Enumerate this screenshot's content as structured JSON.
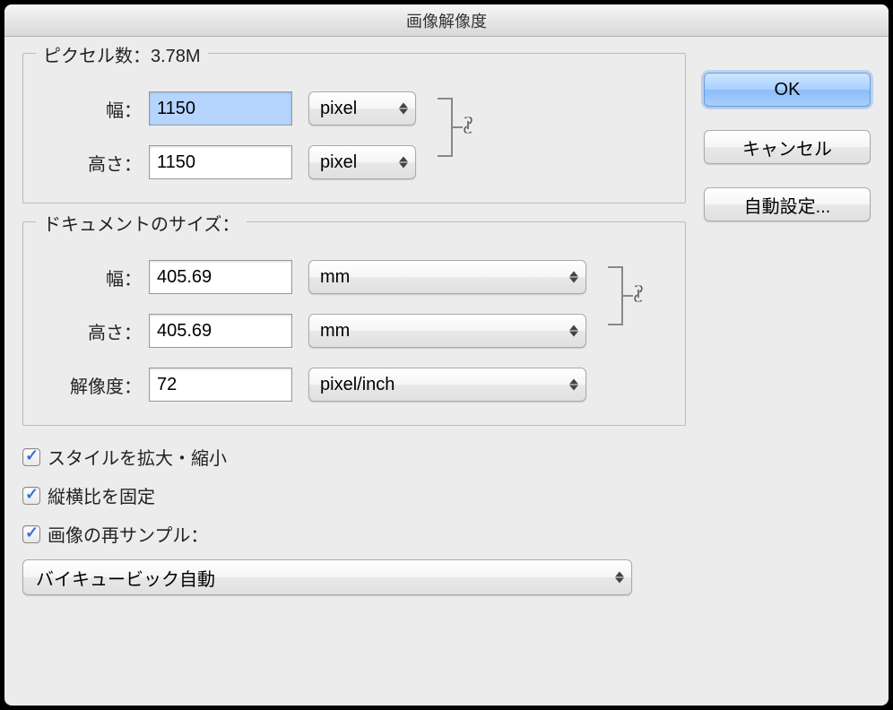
{
  "title": "画像解像度",
  "pixel_section": {
    "legend_prefix": "ピクセル数：",
    "size": "3.78M",
    "width_label": "幅：",
    "width_value": "1150",
    "width_unit": "pixel",
    "height_label": "高さ：",
    "height_value": "1150",
    "height_unit": "pixel"
  },
  "document_section": {
    "legend": "ドキュメントのサイズ：",
    "width_label": "幅：",
    "width_value": "405.69",
    "width_unit": "mm",
    "height_label": "高さ：",
    "height_value": "405.69",
    "height_unit": "mm",
    "resolution_label": "解像度：",
    "resolution_value": "72",
    "resolution_unit": "pixel/inch"
  },
  "checkboxes": {
    "scale_styles": "スタイルを拡大・縮小",
    "constrain": "縦横比を固定",
    "resample": "画像の再サンプル："
  },
  "resample_method": "バイキュービック自動",
  "buttons": {
    "ok": "OK",
    "cancel": "キャンセル",
    "auto": "自動設定..."
  }
}
